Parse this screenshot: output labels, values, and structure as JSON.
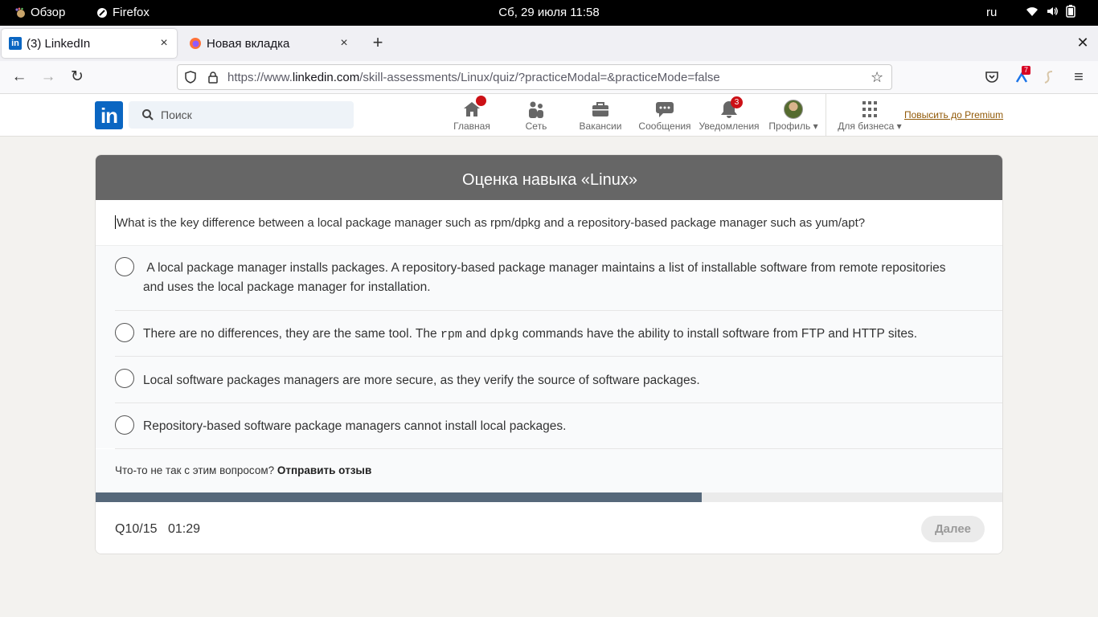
{
  "system_bar": {
    "activities": "Обзор",
    "app_name": "Firefox",
    "datetime": "Сб, 29 июля  11:58",
    "language": "ru",
    "extension_badge": "7"
  },
  "browser": {
    "tabs": [
      {
        "title": "(3) LinkedIn",
        "active": true
      },
      {
        "title": "Новая вкладка",
        "active": false
      }
    ],
    "url_prefix": "https://www.",
    "url_host": "linkedin.com",
    "url_path": "/skill-assessments/Linux/quiz/?practiceModal=&practiceMode=false"
  },
  "linkedin": {
    "logo": "in",
    "search_placeholder": "Поиск",
    "nav": [
      {
        "label": "Главная",
        "icon": "home-icon",
        "badge": ""
      },
      {
        "label": "Сеть",
        "icon": "network-icon",
        "badge": ""
      },
      {
        "label": "Вакансии",
        "icon": "jobs-icon",
        "badge": ""
      },
      {
        "label": "Сообщения",
        "icon": "messaging-icon",
        "badge": ""
      },
      {
        "label": "Уведомления",
        "icon": "bell-icon",
        "badge": "3"
      },
      {
        "label": "Профиль",
        "icon": "avatar",
        "badge": ""
      },
      {
        "label": "Для бизнеса",
        "icon": "grid-icon",
        "badge": ""
      }
    ],
    "premium_link": "Повысить до Premium"
  },
  "assessment": {
    "title": "Оценка навыка «Linux»",
    "question": "What is the key difference between a local package manager such as rpm/dpkg and a repository-based package manager such as yum/apt?",
    "options": [
      {
        "line1": "A local package manager installs packages. A repository-based package manager maintains a list of installable software from remote repositories",
        "line2": "and uses the local package manager for installation."
      },
      {
        "before": "There are no differences, they are the same tool. The ",
        "code1": "rpm",
        "mid": " and ",
        "code2": "dpkg",
        "after": " commands have the ability to install software from FTP and HTTP sites."
      },
      {
        "text": "Local software packages managers are more secure, as they verify the source of software packages."
      },
      {
        "text": "Repository-based software package managers cannot install local packages."
      }
    ],
    "feedback_prompt": "Что-то не так с этим вопросом?",
    "feedback_link": "Отправить отзыв",
    "counter": "Q10/15",
    "timer": "01:29",
    "progress": 0.667,
    "next_label": "Далее"
  }
}
